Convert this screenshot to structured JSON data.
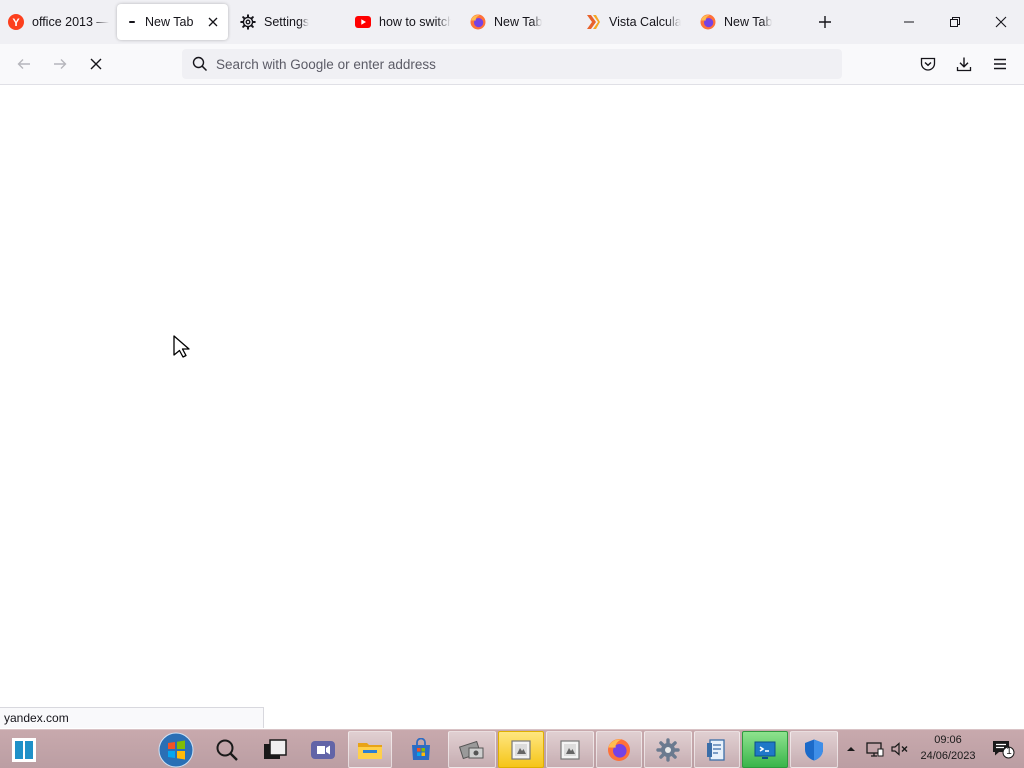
{
  "browser": {
    "tabs": [
      {
        "title": "office 2013 —",
        "favicon": "yandex-icon",
        "active": false
      },
      {
        "title": "New Tab",
        "favicon": "loading-dot-icon",
        "active": true
      },
      {
        "title": "Settings",
        "favicon": "gear-icon",
        "active": false
      },
      {
        "title": "how to switch",
        "favicon": "youtube-icon",
        "active": false
      },
      {
        "title": "New Tab",
        "favicon": "firefox-icon",
        "active": false
      },
      {
        "title": "Vista Calculat",
        "favicon": "vista-calculator-icon",
        "active": false
      },
      {
        "title": "New Tab",
        "favicon": "firefox-icon",
        "active": false
      }
    ],
    "address_bar": {
      "placeholder": "Search with Google or enter address",
      "value": ""
    },
    "status_text": "yandex.com"
  },
  "taskbar": {
    "clock_time": "09:06",
    "clock_date": "24/06/2023",
    "notification_count": "1",
    "items": [
      "start-button",
      "windows-orb-icon",
      "search-icon",
      "task-view-icon",
      "meet-icon",
      "file-explorer-icon",
      "microsoft-store-icon",
      "media-player-icon",
      "image-viewer-icon",
      "image-viewer-2-icon",
      "firefox-icon",
      "settings-icon",
      "notepad-icon",
      "remote-desktop-icon",
      "windows-security-icon"
    ]
  },
  "colors": {
    "tabstrip": "#f0f0f4",
    "navbar": "#f9f9fb",
    "taskbar": "#c8a9ad",
    "accent_yellow": "#f5c518",
    "accent_green": "#39b54a"
  }
}
